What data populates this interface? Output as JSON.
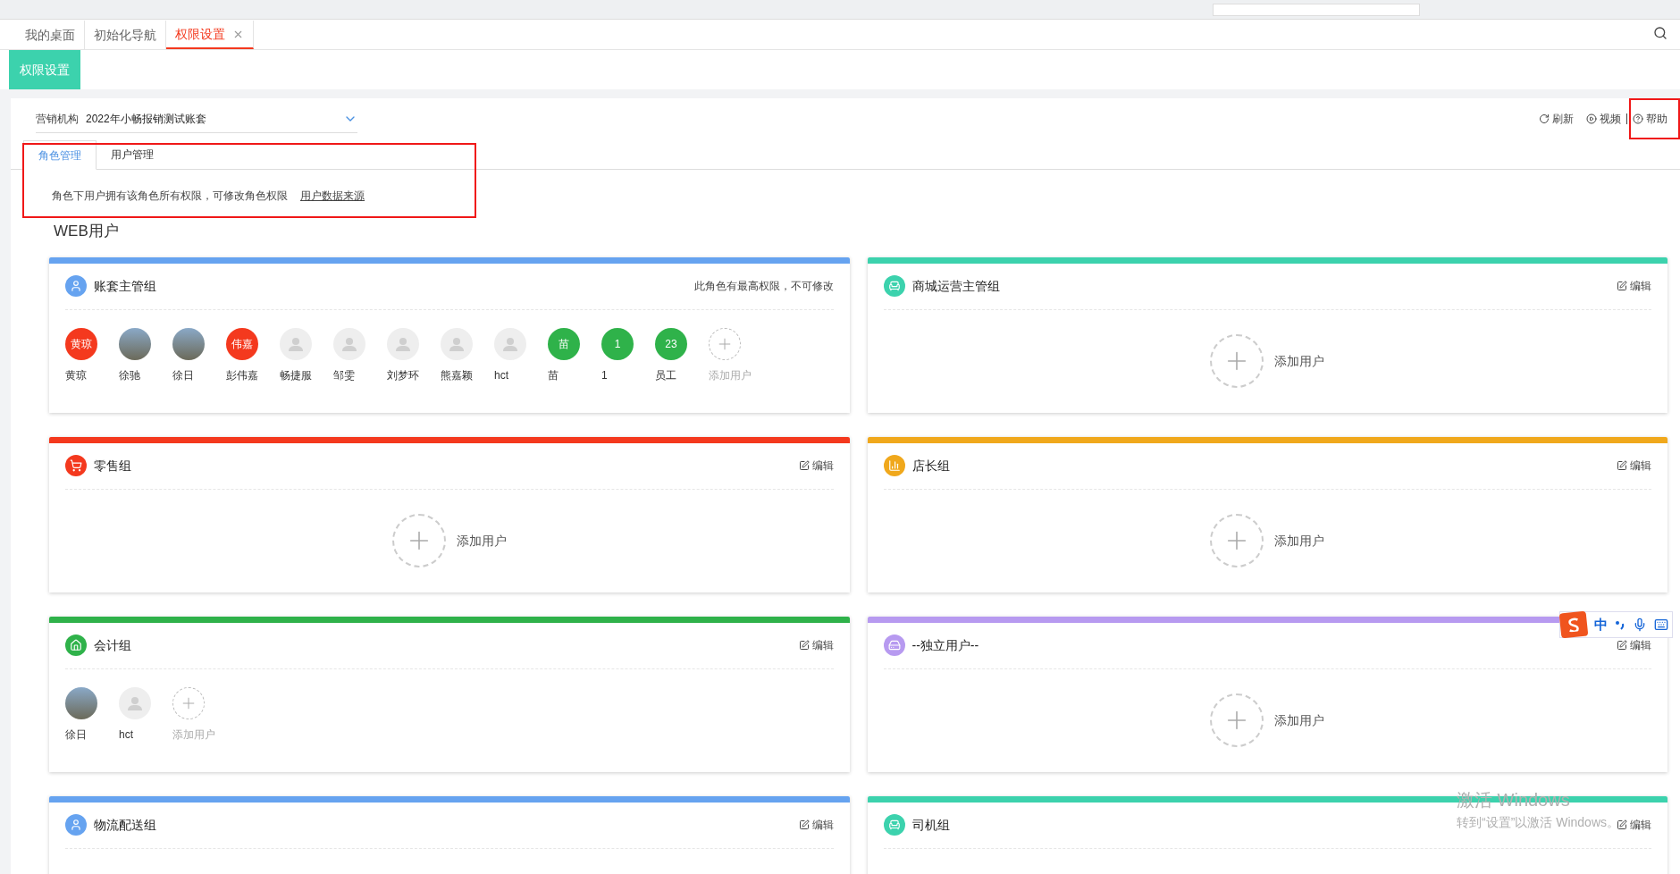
{
  "tabs": [
    {
      "label": "我的桌面",
      "selected": false,
      "closable": false
    },
    {
      "label": "初始化导航",
      "selected": false,
      "closable": false
    },
    {
      "label": "权限设置",
      "selected": true,
      "closable": true
    }
  ],
  "page_title": "权限设置",
  "org": {
    "label": "营销机构",
    "value": "2022年小畅报销测试账套"
  },
  "toolbar": [
    {
      "kind": "refresh",
      "label": "刷新"
    },
    {
      "kind": "video",
      "label": "视频"
    },
    {
      "kind": "help",
      "label": "帮助"
    }
  ],
  "sub_tabs": [
    {
      "label": "角色管理",
      "selected": true
    },
    {
      "label": "用户管理",
      "selected": false
    }
  ],
  "description": "角色下用户拥有该角色所有权限，可修改角色权限",
  "description_link": "用户数据来源",
  "section_title": "WEB用户",
  "groups": [
    {
      "name": "账套主管组",
      "kind": "user",
      "color": "#66a3f0",
      "note": "此角色有最高权限，不可修改",
      "members": [
        {
          "kind": "text",
          "badge": "黄琼",
          "name": "黄琼",
          "color": "#f4391e"
        },
        {
          "kind": "photo",
          "name": "徐驰"
        },
        {
          "kind": "photo",
          "name": "徐日"
        },
        {
          "kind": "text",
          "badge": "伟嘉",
          "name": "彭伟嘉",
          "color": "#f4391e"
        },
        {
          "kind": "blank",
          "name": "畅捷服"
        },
        {
          "kind": "blank",
          "name": "邹雯"
        },
        {
          "kind": "blank",
          "name": "刘梦环"
        },
        {
          "kind": "blank",
          "name": "熊嘉颖"
        },
        {
          "kind": "blank",
          "name": "hct"
        },
        {
          "kind": "text",
          "badge": "苗",
          "name": "苗",
          "color": "#2fb24a"
        },
        {
          "kind": "text",
          "badge": "1",
          "name": "1",
          "color": "#2fb24a"
        },
        {
          "kind": "text",
          "badge": "23",
          "name": "员工",
          "color": "#2fb24a"
        },
        {
          "kind": "add",
          "name": "添加用户"
        }
      ]
    },
    {
      "name": "商城运营主管组",
      "kind": "sofa",
      "color": "#3cd2ad",
      "edit": "编辑",
      "add_label": "添加用户"
    },
    {
      "name": "零售组",
      "kind": "cart",
      "color": "#f4391e",
      "edit": "编辑",
      "add_label": "添加用户"
    },
    {
      "name": "店长组",
      "kind": "chart",
      "color": "#f0a81c",
      "edit": "编辑",
      "add_label": "添加用户"
    },
    {
      "name": "会计组",
      "kind": "house",
      "color": "#2fb24a",
      "edit": "编辑",
      "members": [
        {
          "kind": "photo",
          "name": "徐日"
        },
        {
          "kind": "blank",
          "name": "hct"
        },
        {
          "kind": "add",
          "name": "添加用户"
        }
      ]
    },
    {
      "name": "--独立用户--",
      "kind": "drive",
      "color": "#b79af0",
      "edit": "编辑",
      "add_label": "添加用户"
    },
    {
      "name": "物流配送组",
      "kind": "user",
      "color": "#66a3f0",
      "edit": "编辑"
    },
    {
      "name": "司机组",
      "kind": "sofa",
      "color": "#3cd2ad",
      "edit": "编辑"
    }
  ],
  "ime": {
    "label": "中"
  },
  "os_notice": {
    "title": "激活 Windows",
    "text": "转到“设置”以激活 Windows。"
  }
}
